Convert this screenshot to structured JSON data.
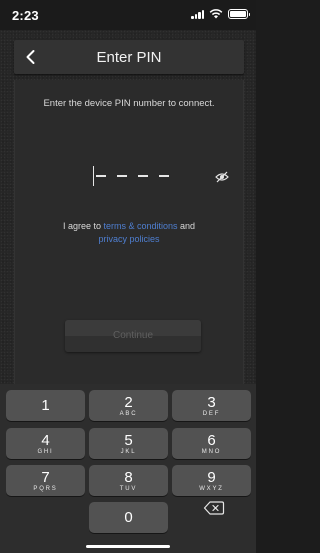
{
  "status_bar": {
    "time": "2:23",
    "icons": [
      "cellular-signal-icon",
      "wifi-icon",
      "battery-icon"
    ]
  },
  "header": {
    "title": "Enter PIN",
    "back_icon": "chevron-left-icon"
  },
  "instruction": "Enter the device PIN number to connect.",
  "pin": {
    "placeholder": "- - - -",
    "toggle_icon": "eye-slash-icon"
  },
  "agreement": {
    "prefix": "I agree to ",
    "terms_link": "terms & conditions",
    "conjunction": " and",
    "privacy_link": "privacy policies"
  },
  "continue_button": "Continue",
  "keypad": {
    "keys": [
      {
        "digit": "1",
        "letters": ""
      },
      {
        "digit": "2",
        "letters": "ABC"
      },
      {
        "digit": "3",
        "letters": "DEF"
      },
      {
        "digit": "4",
        "letters": "GHI"
      },
      {
        "digit": "5",
        "letters": "JKL"
      },
      {
        "digit": "6",
        "letters": "MNO"
      },
      {
        "digit": "7",
        "letters": "PQRS"
      },
      {
        "digit": "8",
        "letters": "TUV"
      },
      {
        "digit": "9",
        "letters": "WXYZ"
      },
      {
        "digit": "0",
        "letters": ""
      }
    ],
    "delete_icon": "backspace-icon"
  },
  "colors": {
    "background": "#262626",
    "link": "#4f7fd1",
    "key": "#525252",
    "keypad_background": "#2d2d2d"
  }
}
